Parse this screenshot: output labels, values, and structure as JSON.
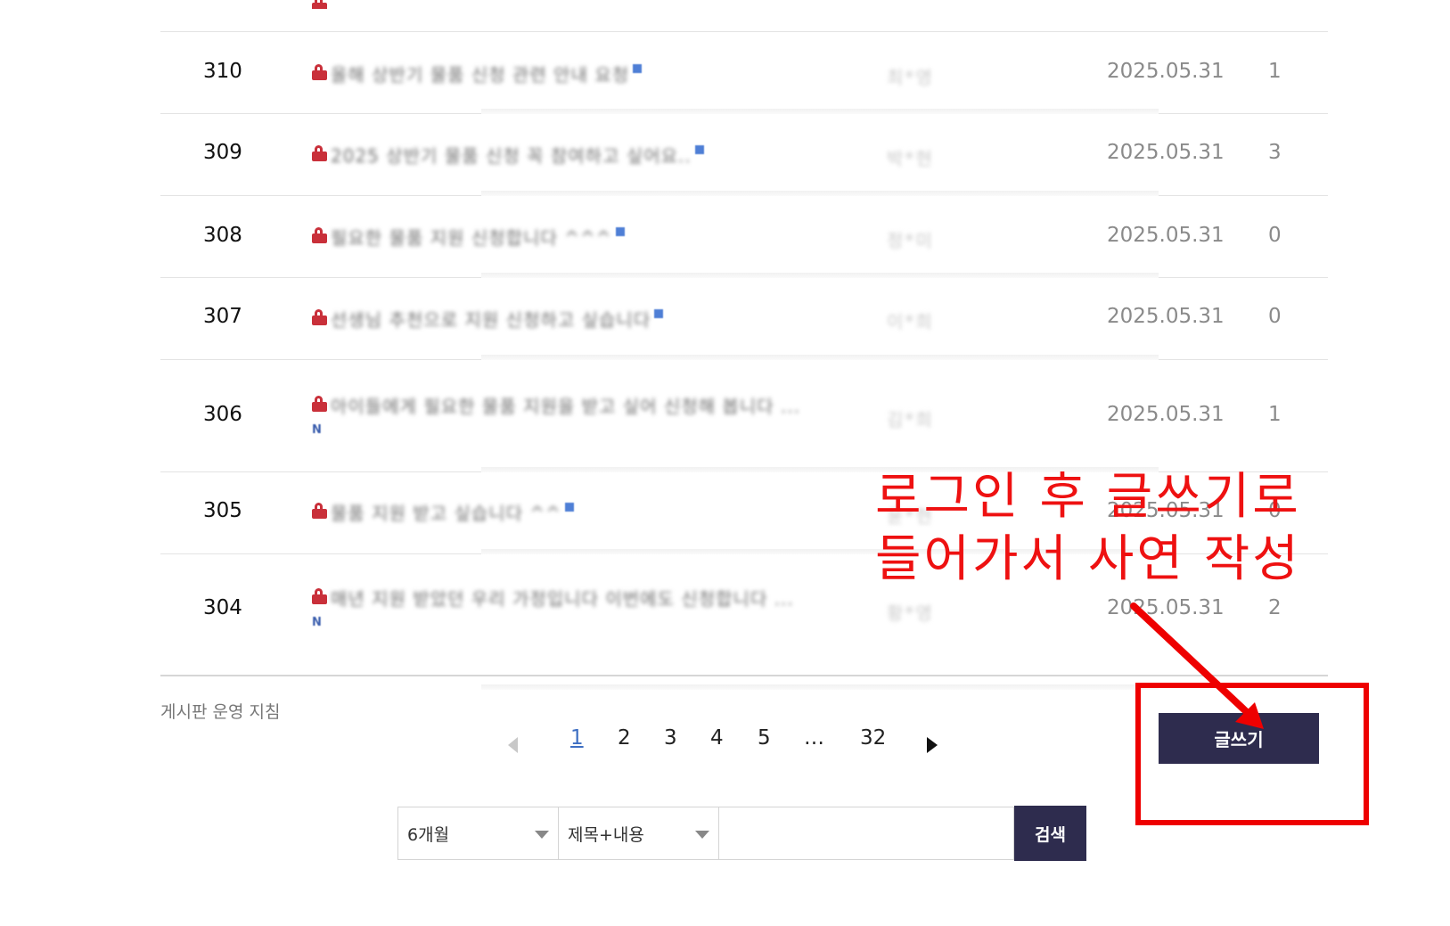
{
  "rows": [
    {
      "num": "310",
      "title": "올해 상반기 물품 신청 관련 안내 요청",
      "author": "최*영",
      "date": "2025.05.31",
      "views": "1",
      "new": false
    },
    {
      "num": "309",
      "title": "2025 상반기 물품 신청 꼭 참여하고 싶어요..",
      "author": "박*현",
      "date": "2025.05.31",
      "views": "3",
      "new": false
    },
    {
      "num": "308",
      "title": "필요한 물품 지원 신청합니다 ^^^",
      "author": "정*미",
      "date": "2025.05.31",
      "views": "0",
      "new": false
    },
    {
      "num": "307",
      "title": "선생님 추천으로 지원 신청하고 싶습니다",
      "author": "이*희",
      "date": "2025.05.31",
      "views": "0",
      "new": false
    },
    {
      "num": "306",
      "title": "아이들에게 필요한 물품 지원을 받고 싶어 신청해 봅니다 ...",
      "author": "김*희",
      "date": "2025.05.31",
      "views": "1",
      "new": true,
      "new_label": "N"
    },
    {
      "num": "305",
      "title": "물품 지원 받고 싶습니다 ^^",
      "author": "윤*현",
      "date": "2025.05.31",
      "views": "0",
      "new": false
    },
    {
      "num": "304",
      "title": "매년 지원 받았던 우리 가정입니다 이번에도 신청합니다 ...",
      "author": "황*영",
      "date": "2025.05.31",
      "views": "2",
      "new": true,
      "new_label": "N"
    }
  ],
  "guide_label": "게시판 운영 지침",
  "pagination": {
    "pages": [
      "1",
      "2",
      "3",
      "4",
      "5"
    ],
    "ellipsis": "…",
    "last": "32",
    "current": "1"
  },
  "write_button": "글쓰기",
  "annotation": {
    "line1": "로그인 후 글쓰기로",
    "line2": "들어가서 사연 작성",
    "color": "#ee0000"
  },
  "search": {
    "period": "6개월",
    "field": "제목+내용",
    "input_value": "",
    "button": "검색"
  },
  "colors": {
    "primary_button": "#2e2c4e",
    "lock_icon": "#c9303a",
    "active_page": "#3e6fc3"
  }
}
